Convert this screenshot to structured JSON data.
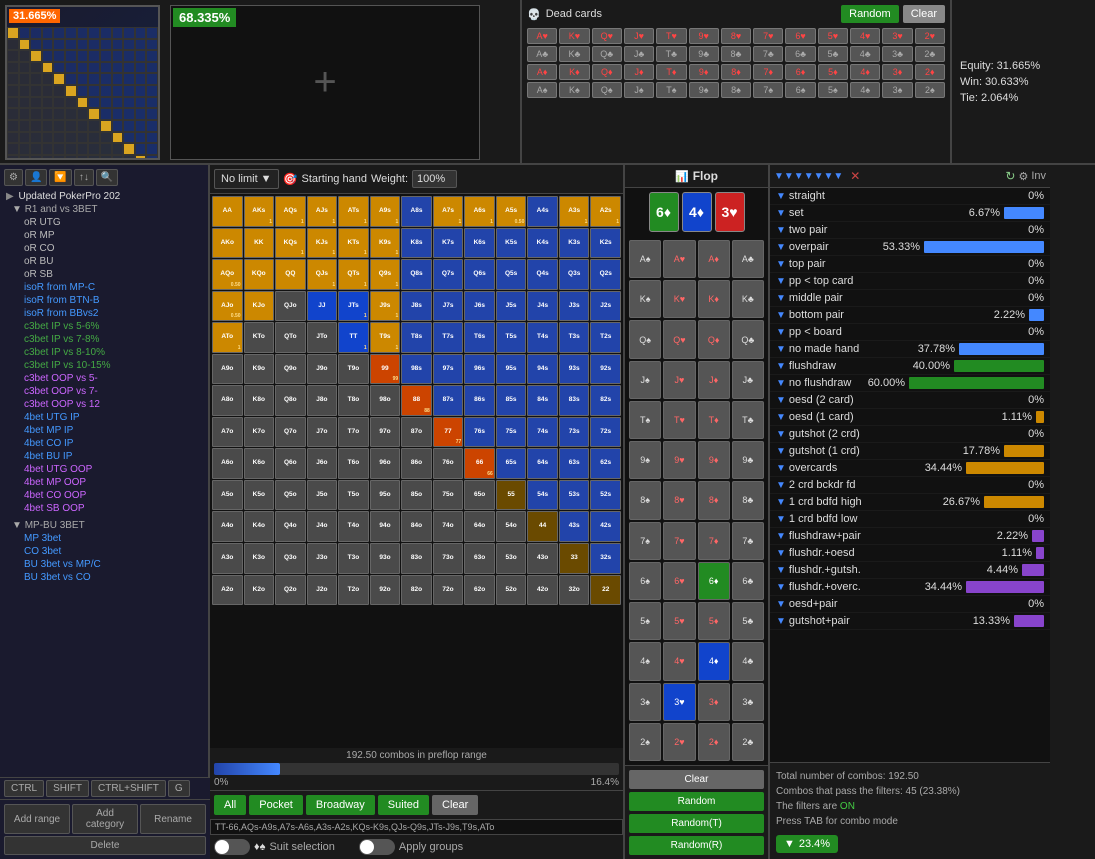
{
  "top": {
    "pct_orange": "31.665%",
    "pct_green": "68.335%",
    "dead_cards_title": "Dead cards",
    "btn_random": "Random",
    "btn_clear": "Clear",
    "equity": {
      "equity_label": "Equity: 31.665%",
      "win_label": "Win: 30.633%",
      "tie_label": "Tie: 2.064%"
    }
  },
  "matrix": {
    "no_limit_label": "No limit",
    "starting_hand_label": "Starting hand",
    "weight_label": "Weight:",
    "weight_value": "100%",
    "progress_combos": "192.50 combos in preflop range",
    "progress_pct": "16.4%",
    "progress_left": "0%",
    "combo_text": "TT-66,AQs-A9s,A7s-A6s,A3s-A2s,KQs-K9s,QJs-Q9s,JTs-J9s,T9s,ATo",
    "buttons": {
      "all": "All",
      "pocket": "Pocket",
      "broadway": "Broadway",
      "suited": "Suited",
      "clear": "Clear"
    },
    "suit_selection": "Suit selection",
    "apply_groups": "Apply groups"
  },
  "flop": {
    "title": "Flop",
    "cards": [
      "6♦",
      "4♦",
      "3♥"
    ],
    "btn_clear": "Clear",
    "btn_random": "Random",
    "btn_random_t": "Random(T)",
    "btn_random_r": "Random(R)"
  },
  "stats": {
    "inv_label": "Inv",
    "filters": [
      {
        "name": "straight",
        "value": "0%",
        "bar": 0,
        "color": "blue"
      },
      {
        "name": "set",
        "value": "6.67%",
        "bar": 40,
        "color": "blue"
      },
      {
        "name": "two pair",
        "value": "0%",
        "bar": 0,
        "color": "blue"
      },
      {
        "name": "overpair",
        "value": "53.33%",
        "bar": 120,
        "color": "blue"
      },
      {
        "name": "top pair",
        "value": "0%",
        "bar": 0,
        "color": "blue"
      },
      {
        "name": "pp < top card",
        "value": "0%",
        "bar": 0,
        "color": "blue"
      },
      {
        "name": "middle pair",
        "value": "0%",
        "bar": 0,
        "color": "blue"
      },
      {
        "name": "bottom pair",
        "value": "2.22%",
        "bar": 15,
        "color": "blue"
      },
      {
        "name": "pp < board",
        "value": "0%",
        "bar": 0,
        "color": "blue"
      },
      {
        "name": "no made hand",
        "value": "37.78%",
        "bar": 85,
        "color": "blue"
      },
      {
        "name": "flushdraw",
        "value": "40.00%",
        "bar": 90,
        "color": "green"
      },
      {
        "name": "no flushdraw",
        "value": "60.00%",
        "bar": 135,
        "color": "green"
      },
      {
        "name": "oesd (2 card)",
        "value": "0%",
        "bar": 0,
        "color": "yellow"
      },
      {
        "name": "oesd (1 card)",
        "value": "1.11%",
        "bar": 8,
        "color": "yellow"
      },
      {
        "name": "gutshot (2 crd)",
        "value": "0%",
        "bar": 0,
        "color": "yellow"
      },
      {
        "name": "gutshot (1 crd)",
        "value": "17.78%",
        "bar": 40,
        "color": "yellow"
      },
      {
        "name": "overcards",
        "value": "34.44%",
        "bar": 78,
        "color": "yellow"
      },
      {
        "name": "2 crd bckdr fd",
        "value": "0%",
        "bar": 0,
        "color": "yellow"
      },
      {
        "name": "1 crd bdfd high",
        "value": "26.67%",
        "bar": 60,
        "color": "yellow"
      },
      {
        "name": "1 crd bdfd low",
        "value": "0%",
        "bar": 0,
        "color": "yellow"
      },
      {
        "name": "flushdraw+pair",
        "value": "2.22%",
        "bar": 12,
        "color": "purple"
      },
      {
        "name": "flushdr.+oesd",
        "value": "1.11%",
        "bar": 8,
        "color": "purple"
      },
      {
        "name": "flushdr.+gutsh.",
        "value": "4.44%",
        "bar": 22,
        "color": "purple"
      },
      {
        "name": "flushdr.+overc.",
        "value": "34.44%",
        "bar": 78,
        "color": "purple"
      },
      {
        "name": "oesd+pair",
        "value": "0%",
        "bar": 0,
        "color": "purple"
      },
      {
        "name": "gutshot+pair",
        "value": "13.33%",
        "bar": 30,
        "color": "purple"
      }
    ],
    "footer": {
      "total": "Total number of combos: 192.50",
      "pass": "Combos that pass the filters: 45 (23.38%)",
      "filters_on": "The filters are ON",
      "tab_hint": "Press TAB for combo mode",
      "badge_pct": "23.4%"
    }
  },
  "tree": {
    "title": "Updated PokerPro 202",
    "root": "R1 and vs 3BET",
    "items": [
      {
        "label": "oR UTG",
        "level": 3
      },
      {
        "label": "oR MP",
        "level": 3
      },
      {
        "label": "oR CO",
        "level": 3
      },
      {
        "label": "oR BU",
        "level": 3
      },
      {
        "label": "oR SB",
        "level": 3
      },
      {
        "label": "isoR from MP-C",
        "level": 3,
        "color": "blue"
      },
      {
        "label": "isoR from BTN-B",
        "level": 3,
        "color": "blue"
      },
      {
        "label": "isoR from BBvs2",
        "level": 3,
        "color": "blue"
      },
      {
        "label": "c3bet IP vs 5-6%",
        "level": 3,
        "color": "green"
      },
      {
        "label": "c3bet IP vs 7-8%",
        "level": 3,
        "color": "green"
      },
      {
        "label": "c3bet IP vs 8-10%",
        "level": 3,
        "color": "green"
      },
      {
        "label": "c3bet IP vs 10-15%",
        "level": 3,
        "color": "green"
      },
      {
        "label": "c3bet OOP vs 5-",
        "level": 3,
        "color": "purple"
      },
      {
        "label": "c3bet OOP vs 7-",
        "level": 3,
        "color": "purple"
      },
      {
        "label": "c3bet OOP vs 12",
        "level": 3,
        "color": "purple"
      },
      {
        "label": "4bet UTG IP",
        "level": 3,
        "color": "blue"
      },
      {
        "label": "4bet MP IP",
        "level": 3,
        "color": "blue"
      },
      {
        "label": "4bet CO IP",
        "level": 3,
        "color": "blue"
      },
      {
        "label": "4bet BU IP",
        "level": 3,
        "color": "blue"
      },
      {
        "label": "4bet UTG OOP",
        "level": 3,
        "color": "purple"
      },
      {
        "label": "4bet MP OOP",
        "level": 3,
        "color": "purple"
      },
      {
        "label": "4bet CO OOP",
        "level": 3,
        "color": "purple"
      },
      {
        "label": "4bet SB OOP",
        "level": 3,
        "color": "purple"
      }
    ],
    "mp_bu_3bet": "MP-BU 3BET",
    "mp_items": [
      {
        "label": "MP 3bet",
        "color": "blue"
      },
      {
        "label": "CO 3bet",
        "color": "blue"
      },
      {
        "label": "BU 3bet vs MP/C",
        "color": "blue"
      },
      {
        "label": "BU 3bet vs CO",
        "color": "blue"
      }
    ],
    "bottom_btns": {
      "ctrl": "CTRL",
      "shift": "SHIFT",
      "ctrl_shift": "CTRL+SHIFT",
      "g": "G",
      "add_range": "Add range",
      "add_category": "Add category",
      "rename": "Rename",
      "delete": "Delete"
    }
  }
}
